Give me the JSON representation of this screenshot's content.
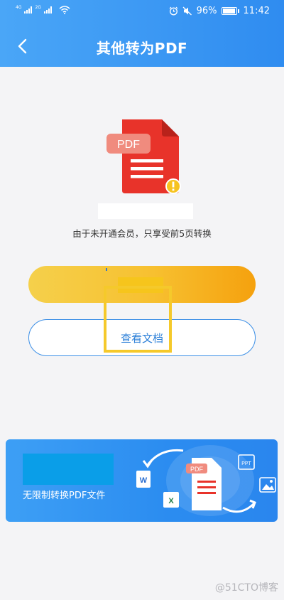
{
  "status_bar": {
    "network_1": "4G",
    "network_2": "2G",
    "battery": "96%",
    "time": "11:42",
    "battery_level": 0.96
  },
  "nav": {
    "title": "其他转为PDF",
    "back_icon": "chevron-left-icon"
  },
  "document": {
    "badge_text": "PDF",
    "warning_icon": "warning-icon"
  },
  "notice": "由于未开通会员，只享受前5页转换",
  "buttons": {
    "view_document": "查看文档"
  },
  "banner": {
    "caption": "无限制转换PDF文件",
    "art_pdf_label": "PDF",
    "art_ppt_label": "PPT",
    "art_word_label": "W",
    "art_excel_label": "X"
  },
  "watermark": "@51CTO博客",
  "colors": {
    "header_blue": "#2f8cf0",
    "pdf_red": "#e8332a",
    "accent_gold": "#f6b825",
    "outline_blue": "#3a8ee6"
  }
}
